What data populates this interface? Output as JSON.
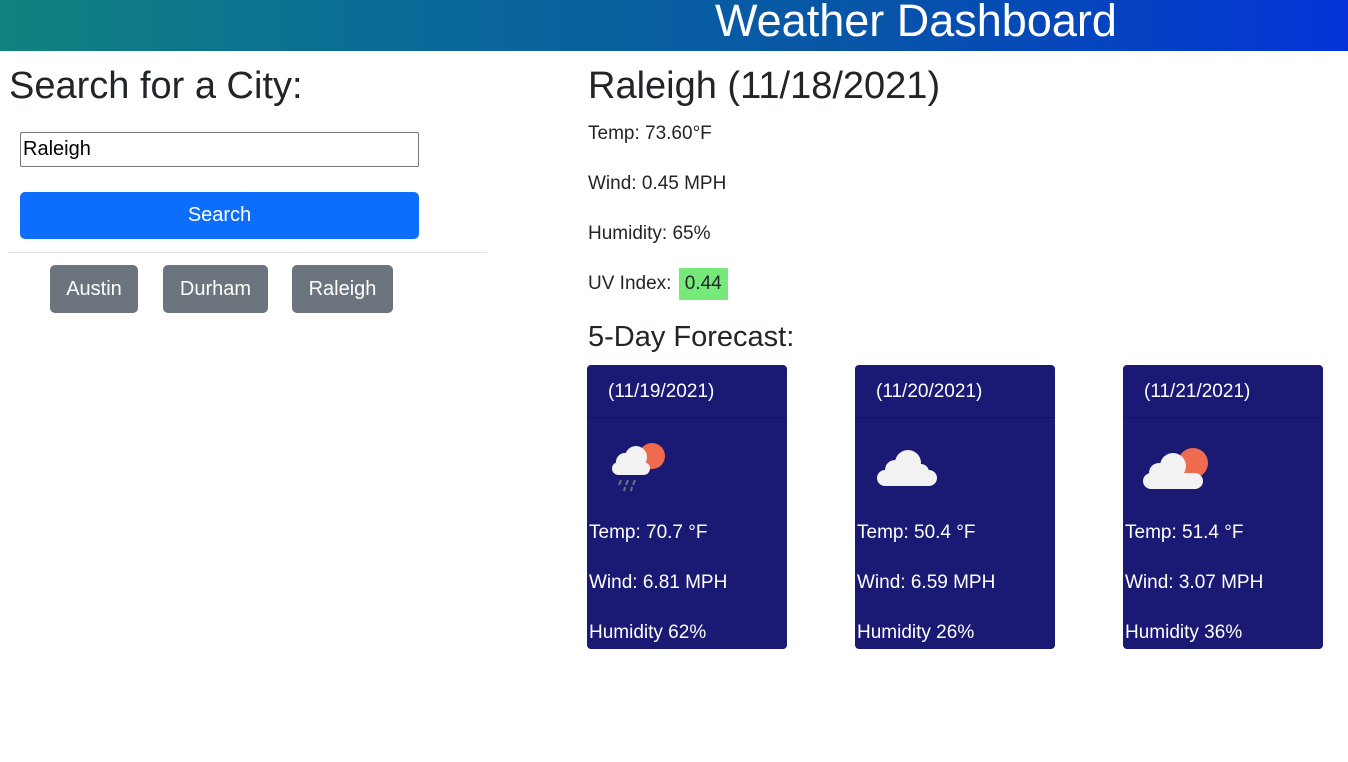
{
  "header": {
    "title": "Weather Dashboard"
  },
  "search": {
    "heading": "Search for a City:",
    "input_value": "Raleigh",
    "button_label": "Search",
    "history": [
      "Austin",
      "Durham",
      "Raleigh"
    ]
  },
  "current": {
    "title": "Raleigh (11/18/2021)",
    "temp": "Temp: 73.60°F",
    "wind": "Wind: 0.45 MPH",
    "humidity": "Humidity: 65%",
    "uv_label": "UV Index:",
    "uv_value": "0.44",
    "uv_color": "#77e87a"
  },
  "forecast": {
    "heading": "5-Day Forecast:",
    "days": [
      {
        "date": "(11/19/2021)",
        "icon": "rain-cloud-sun-icon",
        "temp": "Temp: 70.7 °F",
        "wind": "Wind: 6.81 MPH",
        "humidity": "Humidity 62%"
      },
      {
        "date": "(11/20/2021)",
        "icon": "cloud-icon",
        "temp": "Temp: 50.4 °F",
        "wind": "Wind: 6.59 MPH",
        "humidity": "Humidity 26%"
      },
      {
        "date": "(11/21/2021)",
        "icon": "cloud-sun-icon",
        "temp": "Temp: 51.4 °F",
        "wind": "Wind: 3.07 MPH",
        "humidity": "Humidity 36%"
      }
    ]
  },
  "colors": {
    "accent": "#0d6efd",
    "history_button": "#6c757d",
    "card_background": "#1a1a74"
  }
}
